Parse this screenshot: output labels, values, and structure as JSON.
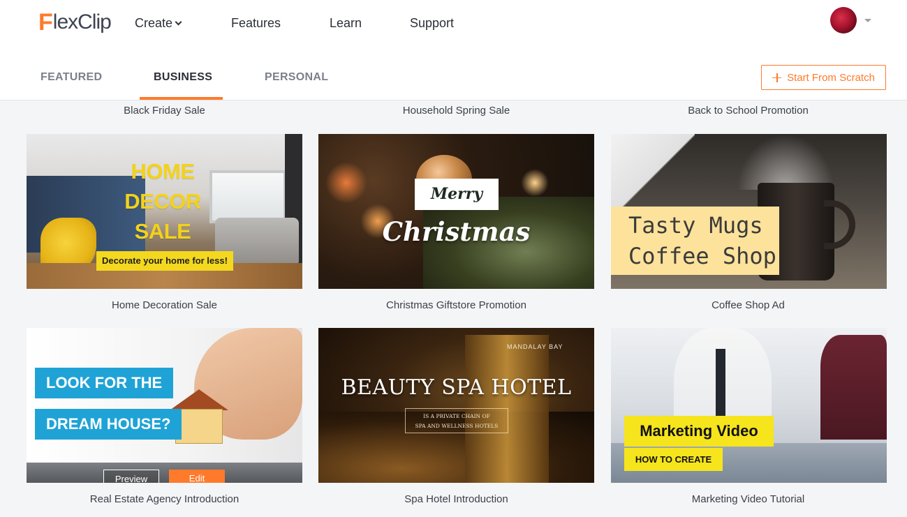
{
  "brand": {
    "logo_f": "F",
    "logo_rest": "lexClip"
  },
  "nav": {
    "create": "Create",
    "features": "Features",
    "learn": "Learn",
    "support": "Support"
  },
  "tabs": [
    "FEATURED",
    "BUSINESS",
    "PERSONAL"
  ],
  "active_tab": "BUSINESS",
  "start_from_scratch": "Start From Scratch",
  "colors": {
    "accent": "#ff7a2b",
    "background": "#f4f5f7",
    "text": "#3a3f47"
  },
  "top_captions": [
    "Black Friday Sale",
    "Household Spring Sale",
    "Back to School Promotion"
  ],
  "templates": [
    {
      "caption": "Home Decoration Sale",
      "lines": [
        "HOME",
        "DECOR",
        "SALE"
      ],
      "sub": "Decorate your home for less!"
    },
    {
      "caption": "Christmas Giftstore Promotion",
      "merry": "Merry",
      "christmas": "Christmas"
    },
    {
      "caption": "Coffee Shop Ad",
      "line1": "Tasty Mugs",
      "line2": "Coffee Shop"
    },
    {
      "caption": "Real Estate Agency Introduction",
      "line1": "LOOK FOR THE",
      "line2": "DREAM HOUSE?",
      "preview": "Preview",
      "edit": "Edit"
    },
    {
      "caption": "Spa Hotel Introduction",
      "brand": "MANDALAY BAY",
      "title": "BEAUTY SPA HOTEL",
      "sub1": "IS A PRIVATE CHAIN OF",
      "sub2": "SPA AND WELLNESS HOTELS"
    },
    {
      "caption": "Marketing Video Tutorial",
      "line1": "Marketing Video",
      "line2": "HOW TO CREATE"
    }
  ],
  "icons": {
    "avatar": "user-avatar",
    "account_menu": "caret-down-icon",
    "create_menu": "chevron-down-icon",
    "add": "plus-icon"
  }
}
